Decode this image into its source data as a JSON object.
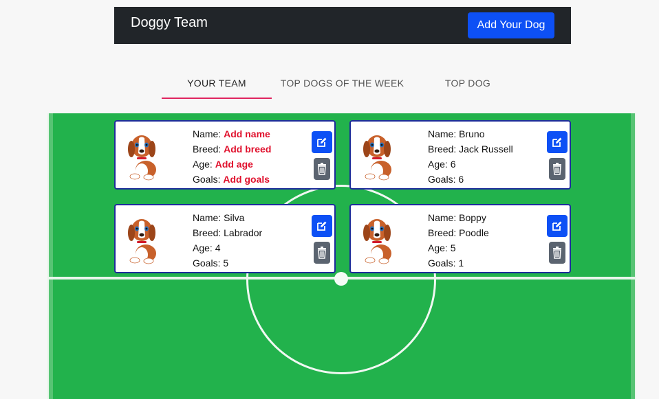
{
  "navbar": {
    "brand": "Doggy Team",
    "add_button": "Add Your Dog"
  },
  "tabs": [
    {
      "label": "YOUR TEAM",
      "active": true
    },
    {
      "label": "TOP DOGS OF THE WEEK",
      "active": false
    },
    {
      "label": "TOP DOG",
      "active": false
    }
  ],
  "labels": {
    "name": "Name: ",
    "breed": "Breed: ",
    "age": "Age: ",
    "goals": "Goals: "
  },
  "dogs": [
    {
      "name": "Add name",
      "breed": "Add breed",
      "age": "Add age",
      "goals": "Add goals"
    },
    {
      "name": "Bruno",
      "breed": "Jack Russell",
      "age": "6",
      "goals": "6"
    },
    {
      "name": "Silva",
      "breed": "Labrador",
      "age": "4",
      "goals": "5"
    },
    {
      "name": "Boppy",
      "breed": "Poodle",
      "age": "5",
      "goals": "1"
    }
  ],
  "colors": {
    "accent": "#0d50f5",
    "tab_indicator": "#e0245e",
    "missing": "#e0102c",
    "field": "#22b24c",
    "delete": "#5b6470"
  },
  "icons": {
    "edit": "edit-icon",
    "delete": "trash-icon",
    "dog": "dog-avatar"
  }
}
